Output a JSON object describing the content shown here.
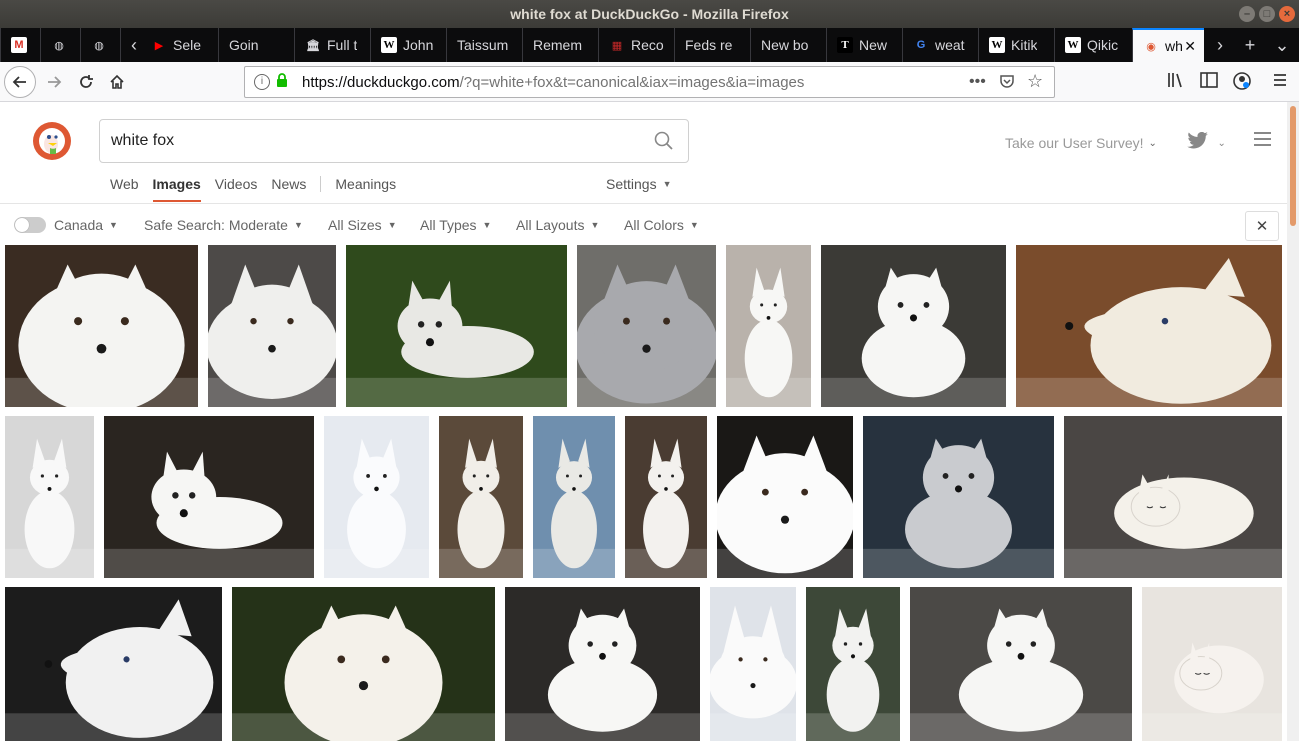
{
  "window": {
    "title": "white fox at DuckDuckGo - Mozilla Firefox"
  },
  "tabs": [
    {
      "label": "",
      "icon": "gmail-icon",
      "color": "#d93025",
      "glyph": "M"
    },
    {
      "label": "",
      "icon": "globe-icon",
      "color": "#d7d7db",
      "glyph": "◍"
    },
    {
      "label": "",
      "icon": "globe-icon",
      "color": "#d7d7db",
      "glyph": "◍"
    },
    {
      "label": "Sele",
      "icon": "youtube-icon",
      "color": "#ff0000",
      "glyph": "▶"
    },
    {
      "label": "Goin",
      "icon": "",
      "color": "",
      "glyph": ""
    },
    {
      "label": "Full t",
      "icon": "building-icon",
      "color": "#d7d7db",
      "glyph": "🏛"
    },
    {
      "label": "John",
      "icon": "wikipedia-icon",
      "color": "#ffffff",
      "glyph": "W"
    },
    {
      "label": "Taissum",
      "icon": "",
      "color": "",
      "glyph": ""
    },
    {
      "label": "Remem",
      "icon": "",
      "color": "",
      "glyph": ""
    },
    {
      "label": "Reco",
      "icon": "news-icon",
      "color": "#c62828",
      "glyph": "▦"
    },
    {
      "label": "Feds re",
      "icon": "",
      "color": "",
      "glyph": ""
    },
    {
      "label": "New bo",
      "icon": "",
      "color": "",
      "glyph": ""
    },
    {
      "label": "New",
      "icon": "t-icon",
      "color": "#ffffff",
      "glyph": "T"
    },
    {
      "label": "weat",
      "icon": "google-icon",
      "color": "#4285f4",
      "glyph": "G"
    },
    {
      "label": "Kitik",
      "icon": "wikipedia-icon",
      "color": "#ffffff",
      "glyph": "W"
    },
    {
      "label": "Qikic",
      "icon": "wikipedia-icon",
      "color": "#ffffff",
      "glyph": "W"
    },
    {
      "label": "wh",
      "icon": "duckduckgo-icon",
      "color": "#de5833",
      "glyph": "◉"
    }
  ],
  "urlbar": {
    "host": "https://duckduckgo.com",
    "rest": "/?q=white+fox&t=canonical&iax=images&ia=images"
  },
  "search": {
    "query": "white fox"
  },
  "header": {
    "survey_label": "Take our User Survey!"
  },
  "verticals": {
    "web": "Web",
    "images": "Images",
    "videos": "Videos",
    "news": "News",
    "meanings": "Meanings",
    "settings": "Settings"
  },
  "filters": {
    "region": "Canada",
    "safe_search": "Safe Search: Moderate",
    "sizes": "All Sizes",
    "types": "All Types",
    "layouts": "All Layouts",
    "colors": "All Colors"
  },
  "colors": {
    "accent": "#de5833",
    "firefox_blue": "#0a84ff"
  }
}
